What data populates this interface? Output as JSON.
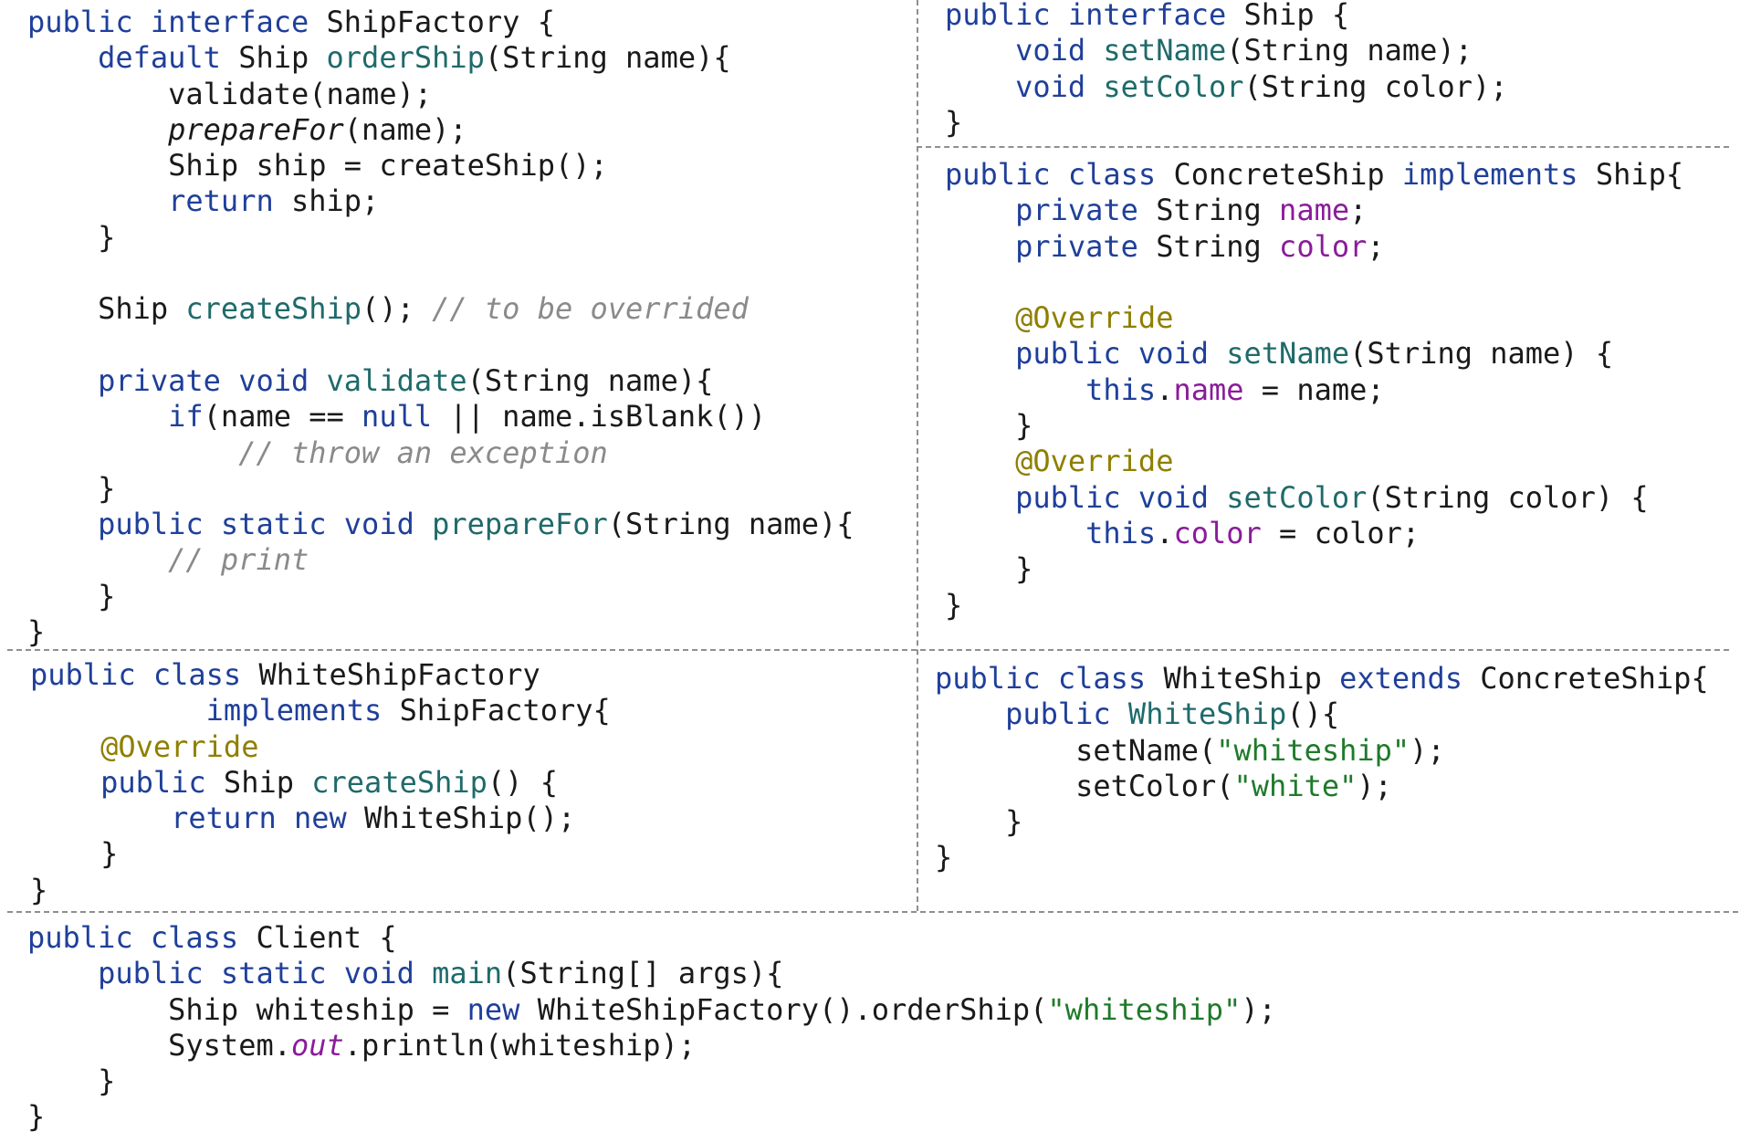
{
  "panels": [
    {
      "id": "ship-factory",
      "lines": [
        [
          [
            "kw",
            "public interface "
          ],
          [
            "plain",
            "ShipFactory {"
          ]
        ],
        [
          [
            "plain",
            "    "
          ],
          [
            "kw",
            "default "
          ],
          [
            "plain",
            "Ship "
          ],
          [
            "fn",
            "orderShip"
          ],
          [
            "plain",
            "(String name){"
          ]
        ],
        [
          [
            "plain",
            "        validate(name);"
          ]
        ],
        [
          [
            "plain",
            "        "
          ],
          [
            "ital",
            "prepareFor"
          ],
          [
            "plain",
            "(name);"
          ]
        ],
        [
          [
            "plain",
            "        Ship ship = createShip();"
          ]
        ],
        [
          [
            "plain",
            "        "
          ],
          [
            "kw",
            "return "
          ],
          [
            "plain",
            "ship;"
          ]
        ],
        [
          [
            "plain",
            "    }"
          ]
        ],
        [
          [
            "plain",
            ""
          ]
        ],
        [
          [
            "plain",
            "    Ship "
          ],
          [
            "fn",
            "createShip"
          ],
          [
            "plain",
            "(); "
          ],
          [
            "com",
            "// to be overrided"
          ]
        ],
        [
          [
            "plain",
            ""
          ]
        ],
        [
          [
            "plain",
            "    "
          ],
          [
            "kw",
            "private void "
          ],
          [
            "fn",
            "validate"
          ],
          [
            "plain",
            "(String name){"
          ]
        ],
        [
          [
            "plain",
            "        "
          ],
          [
            "kw",
            "if"
          ],
          [
            "plain",
            "(name == "
          ],
          [
            "kw",
            "null"
          ],
          [
            "plain",
            " || name.isBlank())"
          ]
        ],
        [
          [
            "plain",
            "            "
          ],
          [
            "com",
            "// throw an exception"
          ]
        ],
        [
          [
            "plain",
            "    }"
          ]
        ],
        [
          [
            "plain",
            "    "
          ],
          [
            "kw",
            "public static void "
          ],
          [
            "fn",
            "prepareFor"
          ],
          [
            "plain",
            "(String name){"
          ]
        ],
        [
          [
            "plain",
            "        "
          ],
          [
            "com",
            "// print"
          ]
        ],
        [
          [
            "plain",
            "    }"
          ]
        ],
        [
          [
            "plain",
            "}"
          ]
        ]
      ]
    },
    {
      "id": "ship-interface",
      "lines": [
        [
          [
            "kw",
            "public interface "
          ],
          [
            "plain",
            "Ship {"
          ]
        ],
        [
          [
            "plain",
            "    "
          ],
          [
            "kw",
            "void "
          ],
          [
            "fn",
            "setName"
          ],
          [
            "plain",
            "(String name);"
          ]
        ],
        [
          [
            "plain",
            "    "
          ],
          [
            "kw",
            "void "
          ],
          [
            "fn",
            "setColor"
          ],
          [
            "plain",
            "(String color);"
          ]
        ],
        [
          [
            "plain",
            "}"
          ]
        ]
      ]
    },
    {
      "id": "concrete-ship",
      "lines": [
        [
          [
            "kw",
            "public class "
          ],
          [
            "plain",
            "ConcreteShip "
          ],
          [
            "kw",
            "implements "
          ],
          [
            "plain",
            "Ship{"
          ]
        ],
        [
          [
            "plain",
            "    "
          ],
          [
            "kw",
            "private "
          ],
          [
            "plain",
            "String "
          ],
          [
            "field",
            "name"
          ],
          [
            "plain",
            ";"
          ]
        ],
        [
          [
            "plain",
            "    "
          ],
          [
            "kw",
            "private "
          ],
          [
            "plain",
            "String "
          ],
          [
            "field",
            "color"
          ],
          [
            "plain",
            ";"
          ]
        ],
        [
          [
            "plain",
            ""
          ]
        ],
        [
          [
            "plain",
            "    "
          ],
          [
            "ann",
            "@Override"
          ]
        ],
        [
          [
            "plain",
            "    "
          ],
          [
            "kw",
            "public void "
          ],
          [
            "fn",
            "setName"
          ],
          [
            "plain",
            "(String name) {"
          ]
        ],
        [
          [
            "plain",
            "        "
          ],
          [
            "kw",
            "this"
          ],
          [
            "plain",
            "."
          ],
          [
            "field",
            "name"
          ],
          [
            "plain",
            " = name;"
          ]
        ],
        [
          [
            "plain",
            "    }"
          ]
        ],
        [
          [
            "plain",
            "    "
          ],
          [
            "ann",
            "@Override"
          ]
        ],
        [
          [
            "plain",
            "    "
          ],
          [
            "kw",
            "public void "
          ],
          [
            "fn",
            "setColor"
          ],
          [
            "plain",
            "(String color) {"
          ]
        ],
        [
          [
            "plain",
            "        "
          ],
          [
            "kw",
            "this"
          ],
          [
            "plain",
            "."
          ],
          [
            "field",
            "color"
          ],
          [
            "plain",
            " = color;"
          ]
        ],
        [
          [
            "plain",
            "    }"
          ]
        ],
        [
          [
            "plain",
            "}"
          ]
        ]
      ]
    },
    {
      "id": "white-ship-factory",
      "lines": [
        [
          [
            "kw",
            "public class "
          ],
          [
            "plain",
            "WhiteShipFactory"
          ]
        ],
        [
          [
            "plain",
            "          "
          ],
          [
            "kw",
            "implements "
          ],
          [
            "plain",
            "ShipFactory{"
          ]
        ],
        [
          [
            "plain",
            "    "
          ],
          [
            "ann",
            "@Override"
          ]
        ],
        [
          [
            "plain",
            "    "
          ],
          [
            "kw",
            "public "
          ],
          [
            "plain",
            "Ship "
          ],
          [
            "fn",
            "createShip"
          ],
          [
            "plain",
            "() {"
          ]
        ],
        [
          [
            "plain",
            "        "
          ],
          [
            "kw",
            "return new "
          ],
          [
            "plain",
            "WhiteShip();"
          ]
        ],
        [
          [
            "plain",
            "    }"
          ]
        ],
        [
          [
            "plain",
            "}"
          ]
        ]
      ]
    },
    {
      "id": "white-ship",
      "lines": [
        [
          [
            "kw",
            "public class "
          ],
          [
            "plain",
            "WhiteShip "
          ],
          [
            "kw",
            "extends "
          ],
          [
            "plain",
            "ConcreteShip{"
          ]
        ],
        [
          [
            "plain",
            "    "
          ],
          [
            "kw",
            "public "
          ],
          [
            "fn",
            "WhiteShip"
          ],
          [
            "plain",
            "(){"
          ]
        ],
        [
          [
            "plain",
            "        setName("
          ],
          [
            "str",
            "\"whiteship\""
          ],
          [
            "plain",
            ");"
          ]
        ],
        [
          [
            "plain",
            "        setColor("
          ],
          [
            "str",
            "\"white\""
          ],
          [
            "plain",
            ");"
          ]
        ],
        [
          [
            "plain",
            "    }"
          ]
        ],
        [
          [
            "plain",
            "}"
          ]
        ]
      ]
    },
    {
      "id": "client",
      "lines": [
        [
          [
            "kw",
            "public class "
          ],
          [
            "plain",
            "Client {"
          ]
        ],
        [
          [
            "plain",
            "    "
          ],
          [
            "kw",
            "public static void "
          ],
          [
            "fn",
            "main"
          ],
          [
            "plain",
            "(String[] args){"
          ]
        ],
        [
          [
            "plain",
            "        Ship whiteship = "
          ],
          [
            "kw",
            "new "
          ],
          [
            "plain",
            "WhiteShipFactory().orderShip("
          ],
          [
            "str",
            "\"whiteship\""
          ],
          [
            "plain",
            ");"
          ]
        ],
        [
          [
            "plain",
            "        System."
          ],
          [
            "staticfield",
            "out"
          ],
          [
            "plain",
            ".println(whiteship);"
          ]
        ],
        [
          [
            "plain",
            "    }"
          ]
        ],
        [
          [
            "plain",
            "}"
          ]
        ]
      ]
    }
  ],
  "colors": {
    "keyword": "#1f3f9a",
    "function": "#1f6a6a",
    "field": "#8a1c9a",
    "string": "#1f7a2a",
    "annotation": "#8f7f00",
    "comment": "#8a8a8a",
    "text": "#1a1a1a",
    "divider": "#8f8f8f"
  }
}
